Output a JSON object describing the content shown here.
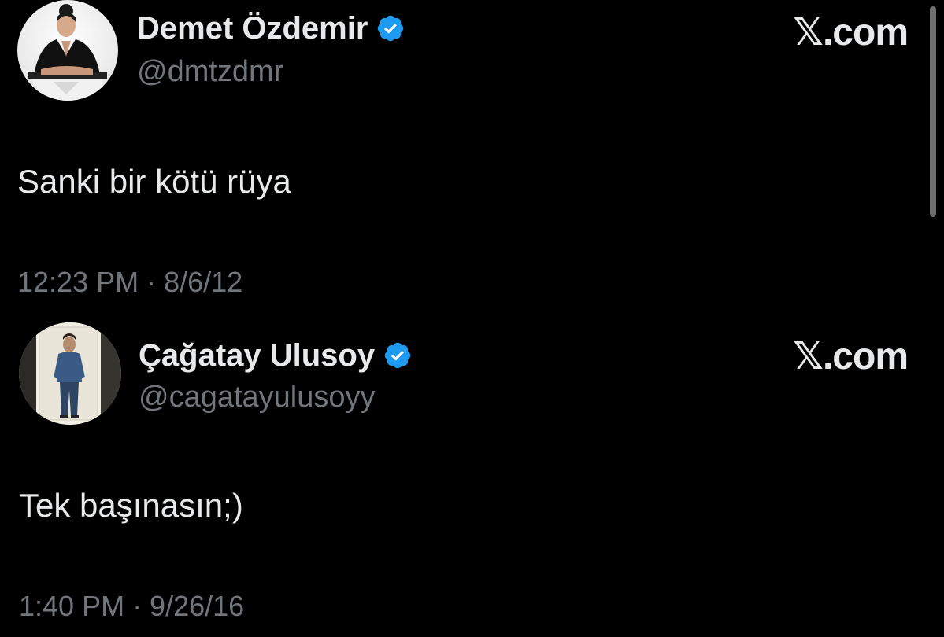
{
  "brand_logo_text": "𝕏.com",
  "colors": {
    "background": "#000000",
    "primary_text": "#e7e9ea",
    "secondary_text": "#71767b",
    "verified_blue": "#1d9bf0"
  },
  "tweets": [
    {
      "display_name": "Demet Özdemir",
      "handle": "@dmtzdmr",
      "verified": true,
      "text": "Sanki bir kötü rüya",
      "timestamp": "12:23 PM · 8/6/12"
    },
    {
      "display_name": "Çağatay Ulusoy",
      "handle": "@cagatayulusoyy",
      "verified": true,
      "text": "Tek başınasın;)",
      "timestamp": "1:40 PM · 9/26/16"
    }
  ],
  "icons": {
    "verified": "verified-badge-icon",
    "scrollbar": "scrollbar"
  }
}
